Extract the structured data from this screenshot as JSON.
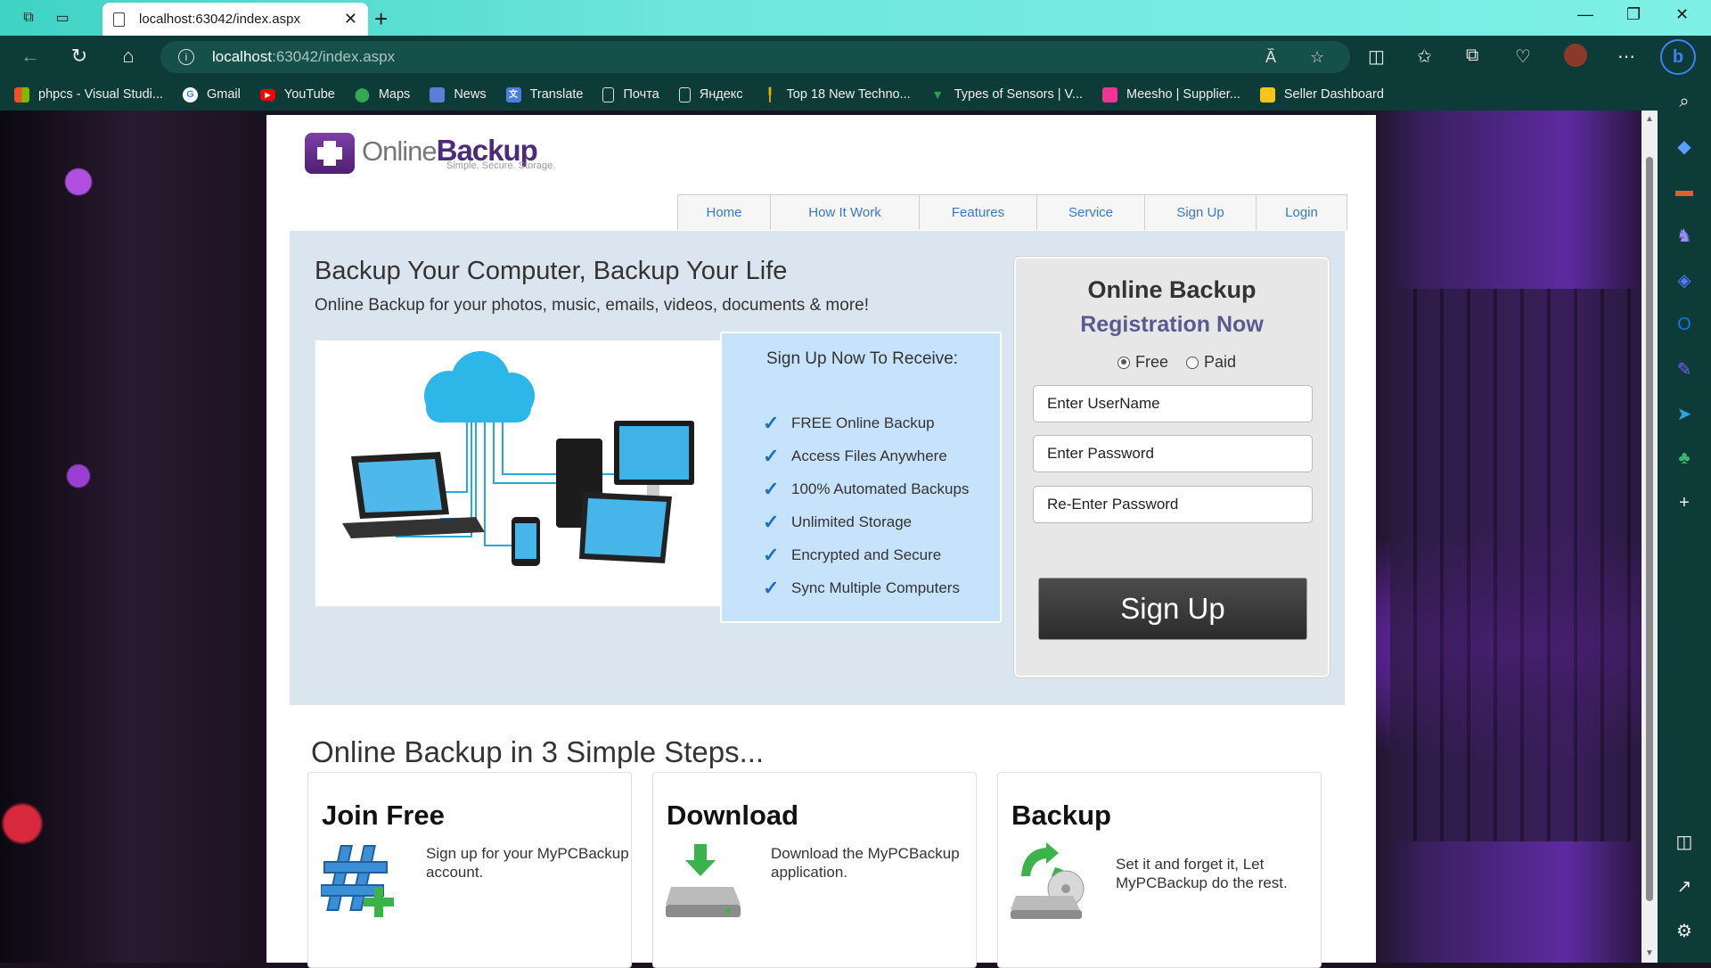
{
  "browser": {
    "tab_title": "localhost:63042/index.aspx",
    "url_host": "localhost",
    "url_rest": ":63042/index.aspx",
    "bookmarks": [
      {
        "label": "phpcs - Visual Studi...",
        "icon": "windows-icon"
      },
      {
        "label": "Gmail",
        "icon": "google-icon"
      },
      {
        "label": "YouTube",
        "icon": "youtube-icon"
      },
      {
        "label": "Maps",
        "icon": "maps-icon"
      },
      {
        "label": "News",
        "icon": "news-icon"
      },
      {
        "label": "Translate",
        "icon": "translate-icon"
      },
      {
        "label": "Почта",
        "icon": "page-icon"
      },
      {
        "label": "Яндекс",
        "icon": "page-icon"
      },
      {
        "label": "Top 18 New Techno...",
        "icon": "tech-icon"
      },
      {
        "label": "Types of Sensors | V...",
        "icon": "sensor-icon"
      },
      {
        "label": "Meesho | Supplier...",
        "icon": "meesho-icon"
      },
      {
        "label": "Seller Dashboard",
        "icon": "seller-icon"
      }
    ],
    "colors": {
      "titlebar": "#6ee6dc",
      "toolbar": "#0d3b37"
    }
  },
  "site": {
    "logo_word1": "Online",
    "logo_word2": "Backup",
    "logo_tagline": "Simple. Secure. Storage.",
    "nav": [
      "Home",
      "How It Work",
      "Features",
      "Service",
      "Sign Up",
      "Login"
    ],
    "hero_title": "Backup Your Computer, Backup Your Life",
    "hero_subtitle": "Online Backup for your photos, music, emails, videos, documents & more!",
    "benefits_title": "Sign Up Now To Receive:",
    "benefits": [
      "FREE Online Backup",
      "Access Files Anywhere",
      "100% Automated Backups",
      "Unlimited Storage",
      "Encrypted and Secure",
      "Sync Multiple Computers"
    ],
    "register": {
      "title": "Online Backup",
      "subtitle": "Registration Now",
      "plan_free": "Free",
      "plan_paid": "Paid",
      "selected_plan": "Free",
      "username_placeholder": "Enter UserName",
      "password_placeholder": "Enter Password",
      "repassword_placeholder": "Re-Enter Password",
      "submit": "Sign Up"
    },
    "steps_heading": "Online Backup in 3 Simple Steps...",
    "steps": [
      {
        "title": "Join Free",
        "text": "Sign up for your MyPCBackup account.",
        "icon": "hashtag-plus-icon"
      },
      {
        "title": "Download",
        "text": "Download the MyPCBackup application.",
        "icon": "download-drive-icon"
      },
      {
        "title": "Backup",
        "text": "Set it and forget it, Let MyPCBackup do the rest.",
        "icon": "backup-sync-icon"
      }
    ]
  }
}
